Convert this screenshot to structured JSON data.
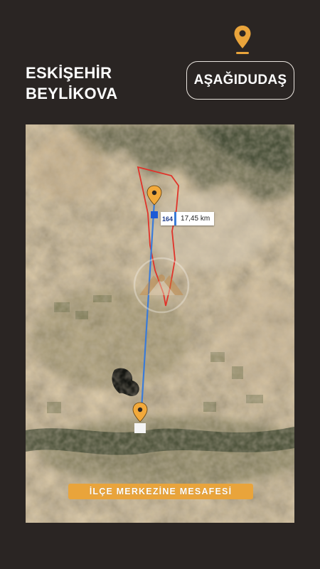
{
  "header": {
    "region_lines": [
      "ESKİŞEHİR",
      "BEYLİKOVA"
    ],
    "village_name": "AŞAĞIDUDAŞ"
  },
  "map": {
    "distance": {
      "code": "164",
      "value": "17,45 km"
    },
    "caption": "İLÇE MERKEZİNE MESAFESİ"
  },
  "colors": {
    "background": "#2a2523",
    "accent": "#e9a43b",
    "route_line": "#3a7bd8",
    "boundary": "#e0332a",
    "pin": "#f2a93b"
  },
  "icons": {
    "header_pin": "location-pin-icon",
    "village_pin": "map-pin-icon",
    "center_pin": "map-pin-icon"
  }
}
